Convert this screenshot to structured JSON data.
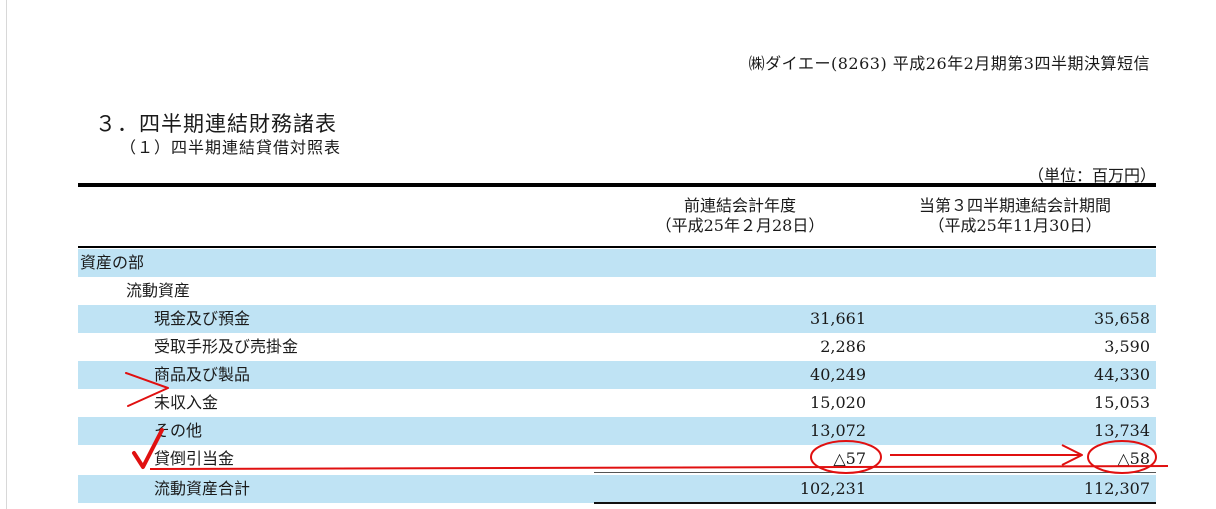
{
  "header": {
    "company_line": "㈱ダイエー(8263) 平成26年2月期第3四半期決算短信"
  },
  "section": {
    "title": "３．四半期連結財務諸表",
    "subtitle": "（１）四半期連結貸借対照表",
    "unit": "（単位：百万円）"
  },
  "columns": {
    "prev_line1": "前連結会計年度",
    "prev_line2": "（平成25年２月28日）",
    "curr_line1": "当第３四半期連結会計期間",
    "curr_line2": "（平成25年11月30日）"
  },
  "rows": [
    {
      "label": "資産の部",
      "prev": "",
      "curr": ""
    },
    {
      "label": "流動資産",
      "prev": "",
      "curr": ""
    },
    {
      "label": "現金及び預金",
      "prev": "31,661",
      "curr": "35,658"
    },
    {
      "label": "受取手形及び売掛金",
      "prev": "2,286",
      "curr": "3,590"
    },
    {
      "label": "商品及び製品",
      "prev": "40,249",
      "curr": "44,330"
    },
    {
      "label": "未収入金",
      "prev": "15,020",
      "curr": "15,053"
    },
    {
      "label": "その他",
      "prev": "13,072",
      "curr": "13,734"
    },
    {
      "label": "貸倒引当金",
      "prev": "△57",
      "curr": "△58"
    },
    {
      "label": "流動資産合計",
      "prev": "102,231",
      "curr": "112,307"
    }
  ],
  "annotation_colors": {
    "red": "#e01010"
  }
}
